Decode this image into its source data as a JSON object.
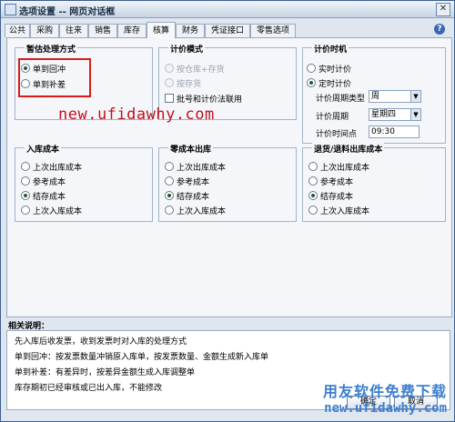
{
  "window": {
    "title": "选项设置 -- 网页对话框",
    "close": "✕"
  },
  "tabs": [
    "公共",
    "采购",
    "往来",
    "销售",
    "库存",
    "核算",
    "财务",
    "凭证接口",
    "零售选项"
  ],
  "active_tab": "核算",
  "help_icon": "?",
  "groups": {
    "temp_estimate": {
      "title": "暂估处理方式",
      "options": [
        "单到回冲",
        "单到补差"
      ],
      "selected": 0
    },
    "pricing_mode": {
      "title": "计价模式",
      "options": [
        "按仓库+存货",
        "按存货"
      ],
      "selected": 0,
      "disabled": true,
      "checkbox": "批号和计价法联用"
    },
    "pricing_time": {
      "title": "计价时机",
      "options": [
        "实时计价",
        "定时计价"
      ],
      "selected": 1,
      "period_type_label": "计价周期类型",
      "period_type_value": "周",
      "period_label": "计价周期",
      "period_value": "星期四",
      "time_label": "计价时间点",
      "time_value": "09:30"
    },
    "in_cost": {
      "title": "入库成本",
      "options": [
        "上次出库成本",
        "参考成本",
        "结存成本",
        "上次入库成本"
      ],
      "selected": 2
    },
    "zero_out": {
      "title": "零成本出库",
      "options": [
        "上次出库成本",
        "参考成本",
        "结存成本",
        "上次入库成本"
      ],
      "selected": 2
    },
    "return_cost": {
      "title": "退货/退料出库成本",
      "options": [
        "上次出库成本",
        "参考成本",
        "结存成本",
        "上次入库成本"
      ],
      "selected": 2
    }
  },
  "watermark_url": "new.ufidawhy.com",
  "notes": {
    "title": "相关说明：",
    "lines": [
      "先入库后收发票，收到发票时对入库的处理方式",
      "单到回冲：按发票数量冲销原入库单，按发票数量、金额生成新入库单",
      "单到补差：有差异时，按差异金额生成入库调整单",
      "库存期初已经审核或已出入库，不能修改"
    ]
  },
  "buttons": {
    "ok": "确定",
    "cancel": "取消"
  },
  "footer_watermark": {
    "cn": "用友软件免费下载",
    "url": "new.ufidawhy.com"
  },
  "colors": {
    "highlight_box": "#d81b1b",
    "watermark_red": "#c0121c",
    "watermark_blue": "#3c7fd0"
  }
}
